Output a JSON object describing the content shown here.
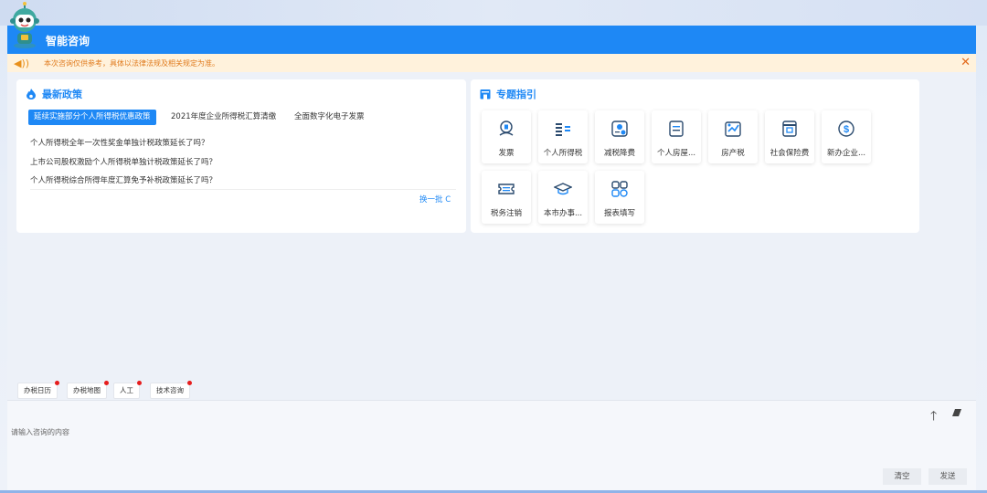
{
  "header": {
    "title": "智能咨询"
  },
  "notice": {
    "text": "本次咨询仅供参考，具体以法律法规及相关规定为准。",
    "close": "✕"
  },
  "policy_card": {
    "title": "最新政策",
    "tabs": [
      "延续实施部分个人所得税优惠政策",
      "2021年度企业所得税汇算清缴",
      "全面数字化电子发票"
    ],
    "items": [
      "个人所得税全年一次性奖金单独计税政策延长了吗？",
      "上市公司股权激励个人所得税单独计税政策延长了吗？",
      "个人所得税综合所得年度汇算免予补税政策延长了吗？"
    ],
    "refresh": "换一批 C"
  },
  "guide_card": {
    "title": "专题指引",
    "tiles": [
      {
        "label": "发票",
        "icon": "invoice-icon"
      },
      {
        "label": "个人所得税",
        "icon": "coins-icon"
      },
      {
        "label": "减税降费",
        "icon": "tax-reduction-icon"
      },
      {
        "label": "个人房屋...",
        "icon": "document-icon"
      },
      {
        "label": "房产税",
        "icon": "house-tax-icon"
      },
      {
        "label": "社会保险费",
        "icon": "insurance-icon"
      },
      {
        "label": "新办企业...",
        "icon": "dollar-icon"
      },
      {
        "label": "税务注销",
        "icon": "ticket-icon"
      },
      {
        "label": "本市办事...",
        "icon": "graduation-cap-icon"
      },
      {
        "label": "报表填写",
        "icon": "grid-icon"
      }
    ]
  },
  "quick_buttons": [
    "办税日历",
    "办税地图",
    "人工",
    "技术咨询"
  ],
  "input": {
    "placeholder": "请输入咨询的内容",
    "clear": "清空",
    "send": "发送"
  },
  "colors": {
    "primary": "#1e88f5",
    "notice_bg": "#fff2dc",
    "notice_text": "#e07a1c",
    "dot": "#e61c1c"
  }
}
